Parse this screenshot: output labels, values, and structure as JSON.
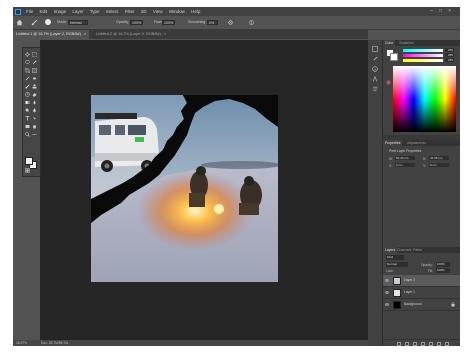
{
  "menubar": {
    "items": [
      "File",
      "Edit",
      "Image",
      "Layer",
      "Type",
      "Select",
      "Filter",
      "3D",
      "View",
      "Window",
      "Help"
    ]
  },
  "options": {
    "mode_label": "Mode:",
    "mode_value": "Normal",
    "opacity_label": "Opacity:",
    "opacity_value": "100%",
    "flow_label": "Flow:",
    "flow_value": "100%",
    "smoothing_label": "Smoothing:",
    "smoothing_value": "0%"
  },
  "tabs": [
    {
      "label": "Untitled-1 @ 16.7% (Layer 2, RGB/8#)",
      "close": "×"
    },
    {
      "label": "Untitled-2 @ 16.7% (Layer 0, RGB/8#)",
      "close": "×"
    }
  ],
  "status": {
    "zoom": "16.67%",
    "doc": "Doc: 25.7M/56.7M"
  },
  "panels": {
    "color": {
      "tabs": [
        "Color",
        "Swatches"
      ],
      "r": "255",
      "g": "255",
      "b": "255"
    },
    "properties": {
      "tabs": [
        "Properties",
        "Adjustments"
      ],
      "title": "Pixel Layer Properties",
      "w_label": "W:",
      "w_value": "50.33 cm",
      "h_label": "H:",
      "h_value": "42.35 cm",
      "x_label": "X:",
      "x_value": "0 cm",
      "y_label": "Y:",
      "y_value": "0 cm"
    },
    "layers": {
      "tabs": [
        "Layers",
        "Channels",
        "Paths"
      ],
      "kind": "Kind",
      "blend": "Normal",
      "opacity_label": "Opacity:",
      "opacity_value": "100%",
      "lock_label": "Lock:",
      "fill_label": "Fill:",
      "fill_value": "100%",
      "items": [
        {
          "name": "Layer 2",
          "selected": true
        },
        {
          "name": "Layer 1",
          "selected": false
        },
        {
          "name": "Background",
          "selected": false
        }
      ]
    }
  },
  "colors": {
    "accent": "#2fa3f7",
    "app_bg": "#535353",
    "canvas_bg": "#262626",
    "panel_bg": "#424242"
  }
}
